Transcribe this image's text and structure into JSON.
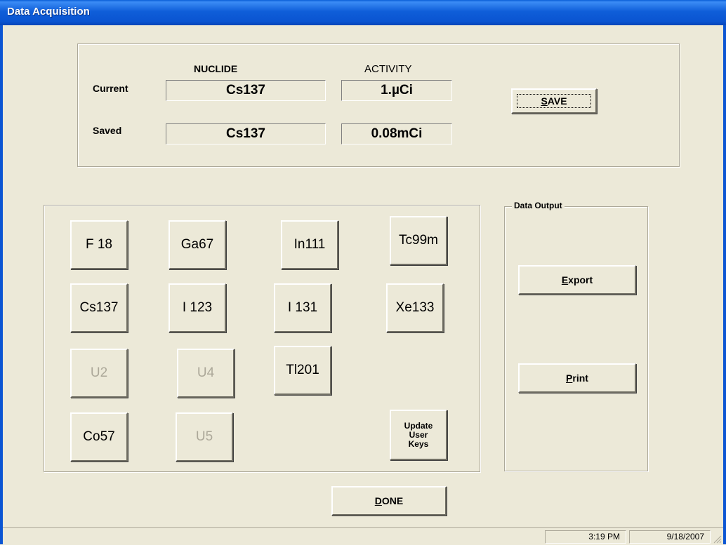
{
  "window": {
    "title": "Data Acquisition"
  },
  "status_panel": {
    "nuclide_header": "NUCLIDE",
    "activity_header": "ACTIVITY",
    "current_label": "Current",
    "saved_label": "Saved",
    "current_nuclide": "Cs137",
    "current_activity": "1.µCi",
    "saved_nuclide": "Cs137",
    "saved_activity": "0.08mCi",
    "save_button": "SAVE",
    "save_mnemonic": "S",
    "save_rest": "AVE"
  },
  "nuclide_keys": [
    {
      "label": "F 18",
      "enabled": true
    },
    {
      "label": "Ga67",
      "enabled": true
    },
    {
      "label": "In111",
      "enabled": true
    },
    {
      "label": "Tc99m",
      "enabled": true
    },
    {
      "label": "Cs137",
      "enabled": true
    },
    {
      "label": "I 123",
      "enabled": true
    },
    {
      "label": "I 131",
      "enabled": true
    },
    {
      "label": "Xe133",
      "enabled": true
    },
    {
      "label": "U2",
      "enabled": false
    },
    {
      "label": "U4",
      "enabled": false
    },
    {
      "label": "Tl201",
      "enabled": true
    },
    {
      "label": "Co57",
      "enabled": true
    },
    {
      "label": "U5",
      "enabled": false
    }
  ],
  "update_user_keys": "Update\nUser\nKeys",
  "data_output": {
    "legend": "Data Output",
    "export_mnemonic": "E",
    "export_rest": "xport",
    "print_mnemonic": "P",
    "print_rest": "rint"
  },
  "done": {
    "mnemonic": "D",
    "rest": "ONE"
  },
  "statusbar": {
    "time": "3:19 PM",
    "date": "9/18/2007"
  }
}
